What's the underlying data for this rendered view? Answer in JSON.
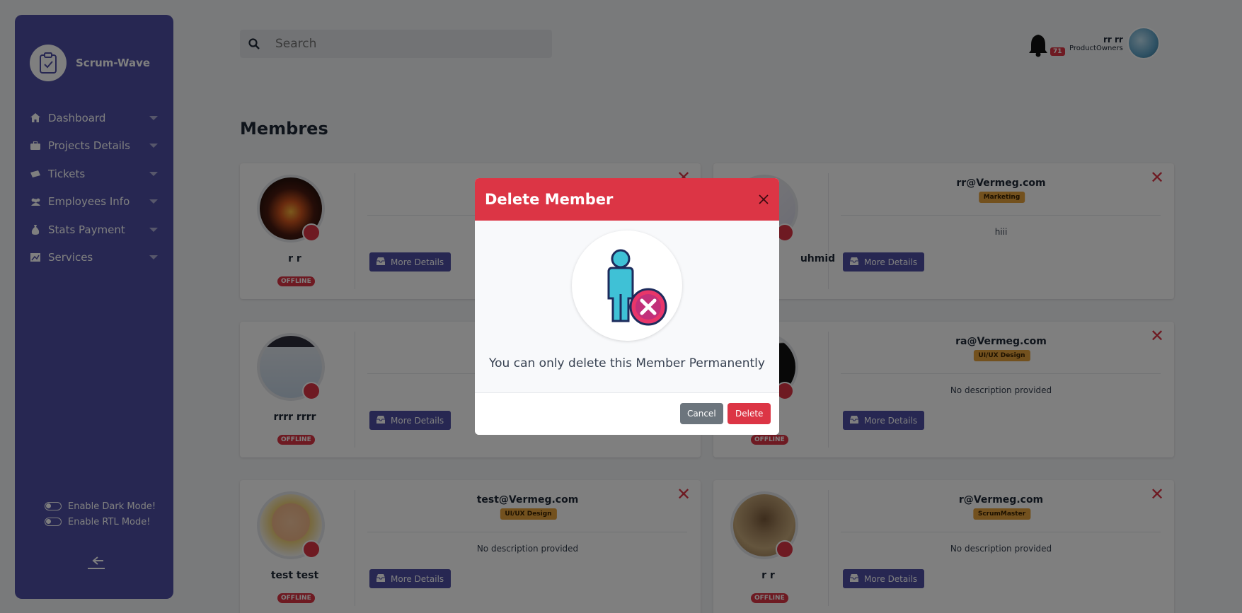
{
  "app": {
    "name": "Scrum-Wave"
  },
  "sidebar": {
    "items": [
      {
        "label": "Dashboard",
        "icon": "home-icon"
      },
      {
        "label": "Projects Details",
        "icon": "briefcase-icon"
      },
      {
        "label": "Tickets",
        "icon": "ticket-icon"
      },
      {
        "label": "Employees Info",
        "icon": "users-icon"
      },
      {
        "label": "Stats Payment",
        "icon": "money-bag-icon"
      },
      {
        "label": "Services",
        "icon": "chart-icon"
      }
    ],
    "dark_mode_label": "Enable Dark Mode!",
    "rtl_mode_label": "Enable RTL Mode!"
  },
  "search": {
    "placeholder": "Search"
  },
  "header": {
    "notification_count": "71",
    "user_name": "rr rr",
    "user_role": "ProductOwners"
  },
  "page": {
    "title": "Membres"
  },
  "members": [
    {
      "name": "r r",
      "email": "",
      "department": "",
      "description": "",
      "status": "OFFLINE",
      "more": "More Details"
    },
    {
      "name": "uhmid",
      "email": "rr@Vermeg.com",
      "department": "Marketing",
      "description": "hiii",
      "status": "",
      "more": "More Details"
    },
    {
      "name": "rrrr rrrr",
      "email": "",
      "department": "",
      "description": "",
      "status": "OFFLINE",
      "more": "More Details"
    },
    {
      "name": "",
      "email": "ra@Vermeg.com",
      "department": "UI/UX Design",
      "description": "No description provided",
      "status": "OFFLINE",
      "more": "More Details"
    },
    {
      "name": "test test",
      "email": "test@Vermeg.com",
      "department": "UI/UX Design",
      "description": "No description provided",
      "status": "OFFLINE",
      "more": "More Details"
    },
    {
      "name": "r r",
      "email": "r@Vermeg.com",
      "department": "ScrumMaster",
      "description": "No description provided",
      "status": "OFFLINE",
      "more": "More Details"
    }
  ],
  "modal": {
    "title": "Delete Member",
    "message": "You can only delete this Member Permanently",
    "cancel_label": "Cancel",
    "delete_label": "Delete"
  },
  "colors": {
    "sidebar": "#4e4fa4",
    "danger": "#dc3545",
    "department_badge": "#e6a23c"
  }
}
